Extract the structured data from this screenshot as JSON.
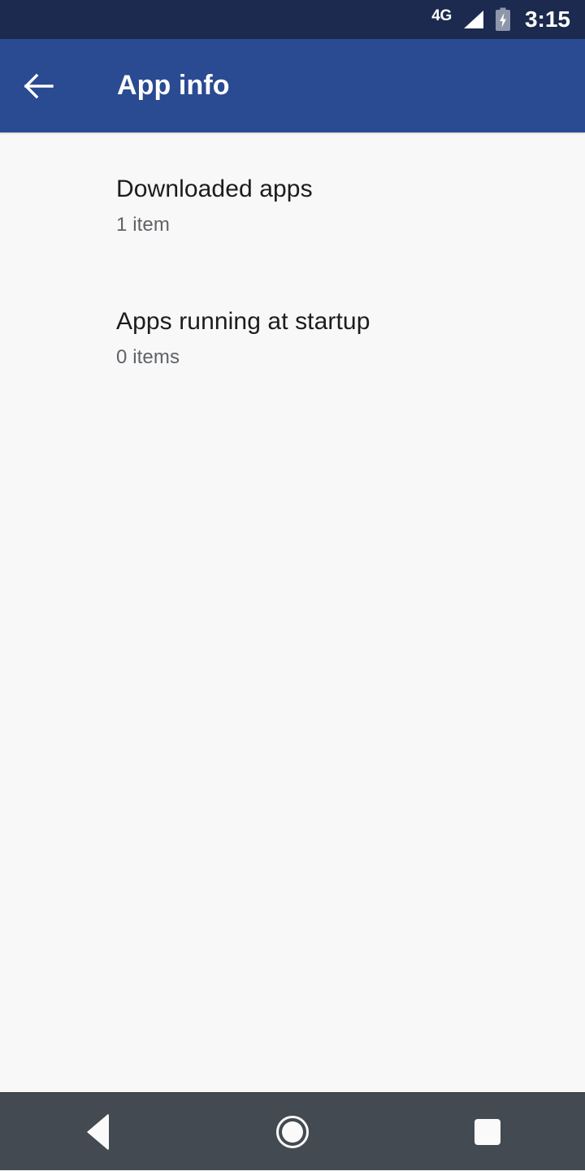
{
  "status_bar": {
    "network_label": "4G",
    "signal_icon": "signal-bars-icon",
    "battery_icon": "battery-charging-icon",
    "clock": "3:15",
    "background_color": "#1b2a4e"
  },
  "app_bar": {
    "back_icon": "arrow-back-icon",
    "title": "App info",
    "background_color": "#2a4a92"
  },
  "content": {
    "background_color": "#f8f8f8",
    "items": [
      {
        "title": "Downloaded apps",
        "subtitle": "1 item"
      },
      {
        "title": "Apps running at startup",
        "subtitle": "0 items"
      }
    ]
  },
  "nav_bar": {
    "background_color": "#434a51",
    "back_icon": "nav-back-triangle-icon",
    "home_icon": "nav-home-circle-icon",
    "recents_icon": "nav-recents-square-icon"
  }
}
